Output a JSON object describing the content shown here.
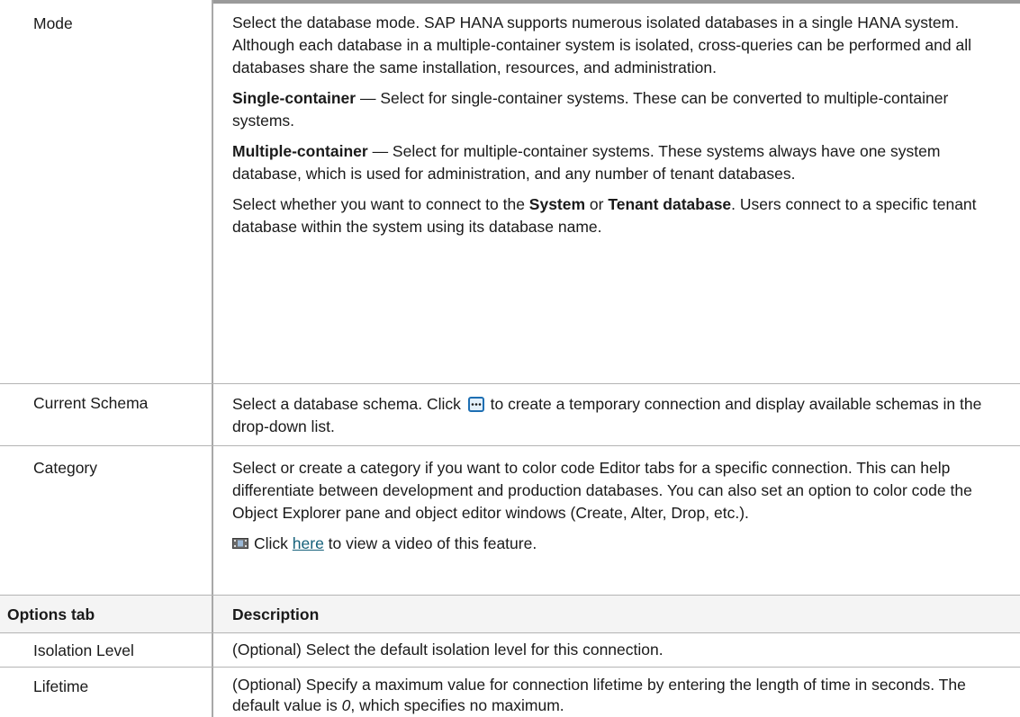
{
  "rows": [
    {
      "label": "Mode",
      "paragraphs": {
        "p1": "Select the database mode. SAP HANA supports numerous isolated databases in a single HANA system. Although each database in a multiple-container system is isolated, cross-queries can be performed and all databases share the same installation, resources, and administration.",
        "p2_bold": "Single-container",
        "p2_rest": " — Select for single-container systems. These can be converted to multiple-container systems.",
        "p3_bold": "Multiple-container",
        "p3_rest": " — Select for multiple-container systems. These systems always have one system database, which is used for administration, and any number of tenant databases.",
        "p4_a": "Select whether you want to connect to the ",
        "p4_b1": "System",
        "p4_c": " or ",
        "p4_b2": "Tenant database",
        "p4_d": ". Users connect to a specific tenant database within the system using its database name."
      }
    },
    {
      "label": "Current Schema",
      "text_a": "Select a database schema. Click ",
      "button_icon": "ellipsis-button-icon",
      "text_b": " to create a temporary connection and display available schemas in the drop-down list."
    },
    {
      "label": "Category",
      "p1": "Select or create a category if you want to color code Editor tabs for a specific connection. This can help differentiate between development and production databases. You can also set an option to color code the Object Explorer pane and object editor windows (Create, Alter, Drop, etc.).",
      "video_icon": "film-icon",
      "video_a": "Click ",
      "video_link": "here",
      "video_b": " to view a video of this feature."
    }
  ],
  "options_header": {
    "col1": "Options tab",
    "col2": "Description"
  },
  "options_rows": [
    {
      "label": "Isolation Level",
      "text": "(Optional) Select the default isolation level for this connection."
    },
    {
      "label": "Lifetime",
      "text_a": "(Optional) Specify a maximum value for connection lifetime by entering the length of time in seconds. The default value is ",
      "text_italic": "0",
      "text_b": ", which specifies no maximum."
    }
  ],
  "colors": {
    "link": "#14607a",
    "header_bg": "#f4f4f4",
    "rule": "#b4b4b4"
  }
}
